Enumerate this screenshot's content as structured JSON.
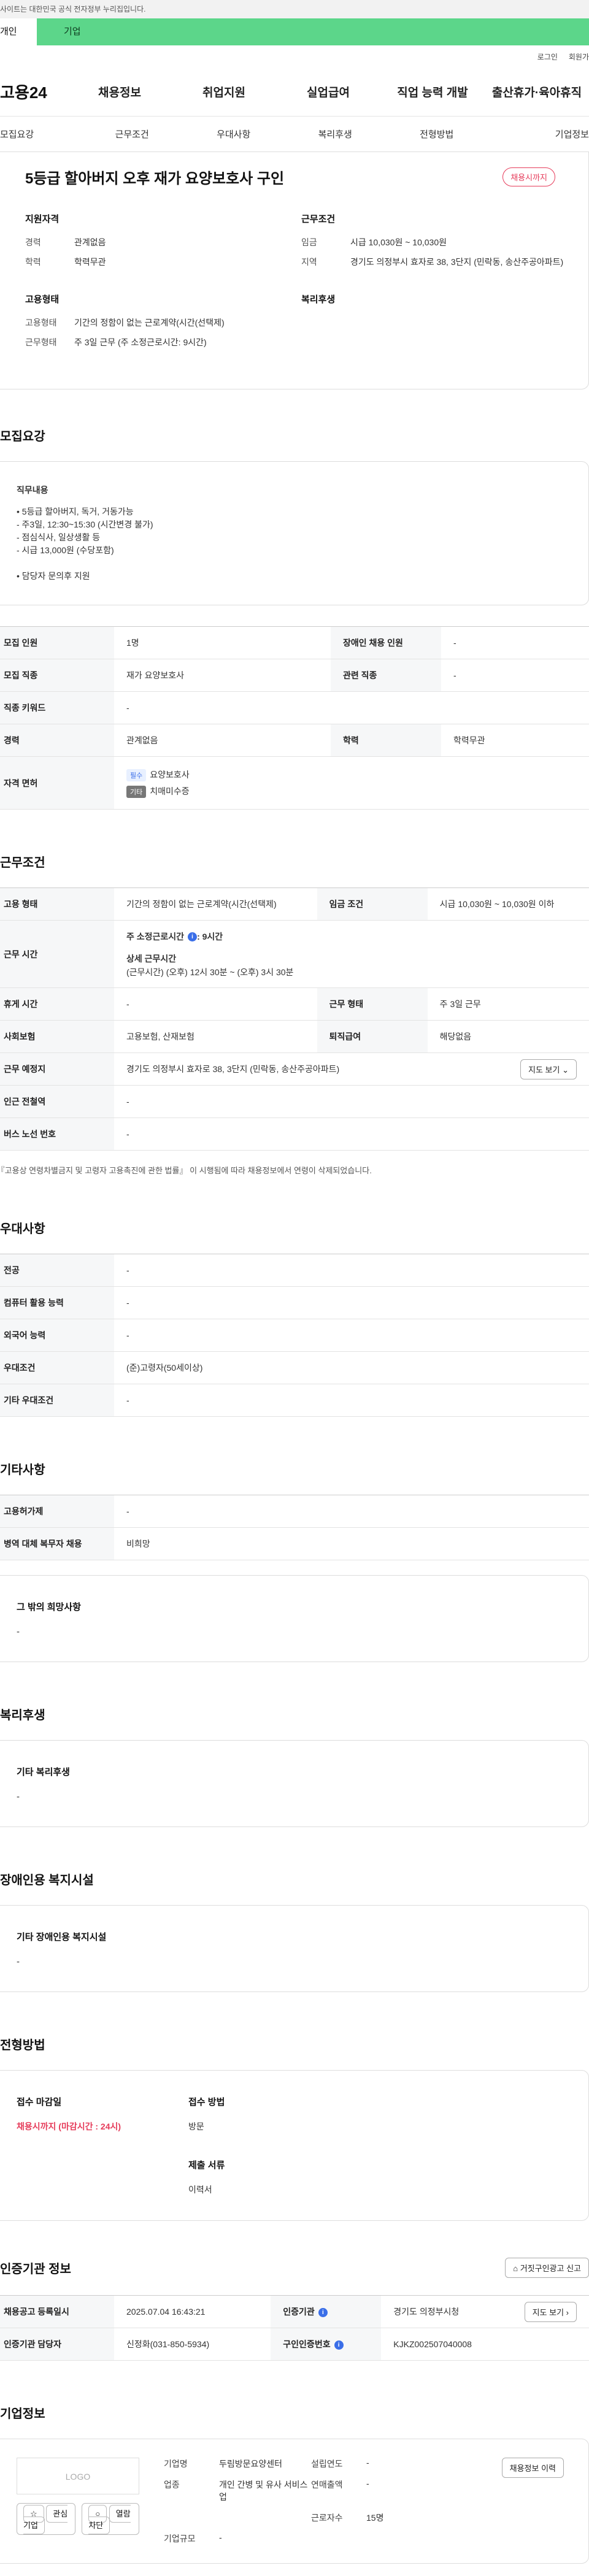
{
  "banner": {
    "text": "사이트는 대한민국 공식 전자정부 누리집입니다."
  },
  "usertabs": {
    "individual": "개인",
    "corporate": "기업"
  },
  "toplinks": {
    "login": "로그인",
    "signup": "회원가"
  },
  "gnb": {
    "logo": "고용24",
    "items": [
      "채용정보",
      "취업지원",
      "실업급여",
      "직업 능력 개발",
      "출산휴가·육아휴직"
    ]
  },
  "subnav": [
    "모집요강",
    "근무조건",
    "우대사항",
    "복리후생",
    "전형방법",
    "기업정보"
  ],
  "header": {
    "title": "5등급 할아버지 오후 재가 요양보호사 구인",
    "deadline_badge": "채용시까지"
  },
  "summary": {
    "qual_head": "지원자격",
    "qual": [
      {
        "k": "경력",
        "v": "관계없음"
      },
      {
        "k": "학력",
        "v": "학력무관"
      }
    ],
    "cond_head": "근무조건",
    "cond": [
      {
        "k": "임금",
        "v": "시급 10,030원 ~ 10,030원"
      },
      {
        "k": "지역",
        "v": "경기도 의정부시 효자로 38, 3단지 (민락동, 송산주공아파트)"
      }
    ],
    "emp_head": "고용형태",
    "emp": [
      {
        "k": "고용형태",
        "v": "기간의 정함이 없는 근로계약(시간(선택제)"
      },
      {
        "k": "근무형태",
        "v": "주 3일 근무 (주 소정근로시간: 9시간)"
      }
    ],
    "welfare_head": "복리후생"
  },
  "recruit": {
    "title": "모집요강",
    "desc_head": "직무내용",
    "desc_lines": [
      "• 5등급 할아버지, 독거, 거동가능",
      "- 주3일, 12:30~15:30 (시간변경 불가)",
      "- 점심식사, 일상생활 등",
      "- 시급 13,000원 (수당포함)",
      "",
      "• 담당자 문의후 지원"
    ],
    "rows": [
      {
        "k1": "모집 인원",
        "v1": "1명",
        "k2": "장애인 채용 인원",
        "v2": "-"
      },
      {
        "k1": "모집 직종",
        "v1": "재가 요양보호사",
        "k2": "관련 직종",
        "v2": "-"
      },
      {
        "k1": "직종 키워드",
        "v1": "-"
      },
      {
        "k1": "경력",
        "v1": "관계없음",
        "k2": "학력",
        "v2": "학력무관"
      }
    ],
    "license_label": "자격 면허",
    "license": [
      {
        "badge": "필수",
        "name": "요양보호사"
      },
      {
        "badge": "기타",
        "name": "치매미수증"
      }
    ]
  },
  "work": {
    "title": "근무조건",
    "emp_k": "고용 형태",
    "emp_v": "기간의 정함이 없는 근로계약(시간(선택제)",
    "wage_k": "임금 조건",
    "wage_v": "시급 10,030원 ~ 10,030원 이하",
    "time_k": "근무 시간",
    "time_v1": "주 소정근로시간",
    "time_v1b": ": 9시간",
    "time_v2": "상세 근무시간",
    "time_v3": "(근무시간) (오후) 12시 30분 ~ (오후) 3시 30분",
    "rest_k": "휴게 시간",
    "rest_v": "-",
    "form_k": "근무 형태",
    "form_v": "주 3일 근무",
    "ins_k": "사회보험",
    "ins_v": "고용보험, 산재보험",
    "ret_k": "퇴직급여",
    "ret_v": "해당없음",
    "place_k": "근무 예정지",
    "place_v": "경기도 의정부시 효자로 38, 3단지 (민락동, 송산주공아파트)",
    "map_btn": "지도 보기",
    "sub_k": "인근 전철역",
    "sub_v": "-",
    "bus_k": "버스 노선 번호",
    "bus_v": "-",
    "note": "* 『고용상 연령차별금지 및 고령자 고용촉진에 관한 법률』 이 시행됨에 따라 채용정보에서 연령이 삭제되었습니다."
  },
  "pref": {
    "title": "우대사항",
    "rows": [
      {
        "k": "전공",
        "v": "-"
      },
      {
        "k": "컴퓨터 활용 능력",
        "v": "-"
      },
      {
        "k": "외국어 능력",
        "v": "-"
      },
      {
        "k": "우대조건",
        "v": "(준)고령자(50세이상)"
      },
      {
        "k": "기타 우대조건",
        "v": "-"
      }
    ]
  },
  "etc": {
    "title": "기타사항",
    "rows": [
      {
        "k": "고용허가제",
        "v": "-"
      },
      {
        "k": "병역 대체 복무자 채용",
        "v": "비희망"
      }
    ],
    "other_head": "그 밖의 희망사항",
    "other_v": "-"
  },
  "welfare": {
    "title": "복리후생",
    "head": "기타 복리후생",
    "v": "-"
  },
  "disabled": {
    "title": "장애인용 복지시설",
    "head": "기타 장애인용 복지시설",
    "v": "-"
  },
  "apply": {
    "title": "전형방법",
    "deadline_head": "접수 마감일",
    "deadline_v": "채용시까지 (마감시간 : 24시)",
    "method_head": "접수 방법",
    "method_v": "방문",
    "docs_head": "제출 서류",
    "docs_v": "이력서"
  },
  "cert": {
    "title": "인증기관 정보",
    "report_btn": "거짓구인광고 신고",
    "r1k1": "채용공고 등록일시",
    "r1v1": "2025.07.04 16:43:21",
    "r1k2": "인증기관",
    "r1v2": "경기도 의정부시청",
    "map_btn": "지도 보기",
    "r2k1": "인증기관 담당자",
    "r2v1": "신정화(031-850-5934)",
    "r2k2": "구인인증번호",
    "r2v2": "KJKZ002507040008"
  },
  "company": {
    "title": "기업정보",
    "logo": "LOGO",
    "btn_fav": "관심기업",
    "btn_block": "열람차단",
    "name_k": "기업명",
    "name_v": "두림방문요양센터",
    "est_k": "설립연도",
    "est_v": "-",
    "ind_k": "업종",
    "ind_v": "개인 간병 및 유사 서비스업",
    "rev_k": "연매출액",
    "rev_v": "-",
    "emp_k": "근로자수",
    "emp_v": "15명",
    "size_k": "기업규모",
    "size_v": "-",
    "btn_jobs": "채용정보 이력"
  }
}
